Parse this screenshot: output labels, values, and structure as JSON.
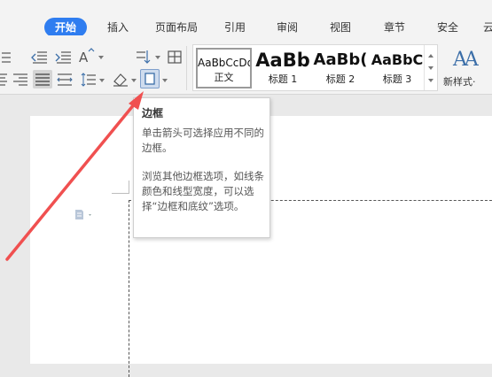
{
  "tabs": [
    {
      "label": "开始",
      "active": true
    },
    {
      "label": "插入"
    },
    {
      "label": "页面布局"
    },
    {
      "label": "引用"
    },
    {
      "label": "审阅"
    },
    {
      "label": "视图"
    },
    {
      "label": "章节"
    },
    {
      "label": "安全"
    },
    {
      "label": "云"
    }
  ],
  "styles": [
    {
      "sample": "AaBbCcDd",
      "name": "正文",
      "selected": true
    },
    {
      "sample": "AaBb",
      "name": "标题 1"
    },
    {
      "sample": "AaBb(",
      "name": "标题 2"
    },
    {
      "sample": "AaBbC",
      "name": "标题 3"
    }
  ],
  "new_style": {
    "icon_text": "AA",
    "label": "新样式·"
  },
  "tooltip": {
    "title": "边框",
    "para1": "单击箭头可选择应用不同的边框。",
    "para2": "浏览其他边框选项，如线条颜色和线型宽度，可以选择“边框和底纹”选项。"
  },
  "colors": {
    "accent": "#2f7df0",
    "annotation_arrow": "#f05050"
  },
  "icons": {
    "ribbon_row1": [
      "bullet-list-icon",
      "decrease-indent-icon",
      "increase-indent-icon",
      "font-size-icon",
      "sort-icon",
      "table-icon"
    ],
    "ribbon_row2": [
      "align-left-icon",
      "align-right-icon",
      "justify-icon",
      "distributed-icon",
      "line-spacing-icon",
      "shading-icon",
      "border-icon"
    ],
    "document": [
      "paragraph-mark-icon"
    ]
  }
}
